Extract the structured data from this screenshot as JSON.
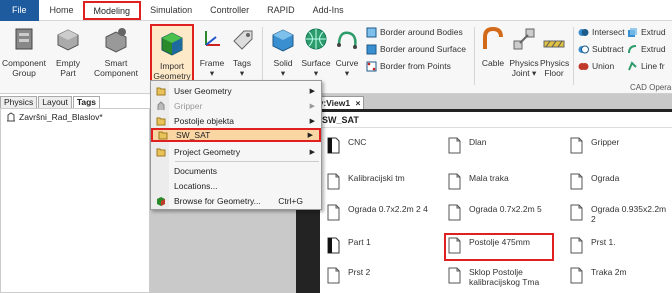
{
  "menu_tabs": [
    "File",
    "Home",
    "Modeling",
    "Simulation",
    "Controller",
    "RAPID",
    "Add-Ins"
  ],
  "ribbon": {
    "buttons": [
      {
        "label1": "Component",
        "label2": "Group"
      },
      {
        "label1": "Empty",
        "label2": "Part"
      },
      {
        "label1": "Smart",
        "label2": "Component"
      },
      {
        "label1": "Import",
        "label2": "Geometry ▾"
      },
      {
        "label1": "Frame",
        "label2": "▾"
      },
      {
        "label1": "Tags",
        "label2": "▾"
      },
      {
        "label1": "Solid",
        "label2": "▾"
      },
      {
        "label1": "Surface",
        "label2": "▾"
      },
      {
        "label1": "Curve",
        "label2": "▾"
      },
      {
        "label1": "Cable",
        "label2": ""
      },
      {
        "label1": "Physics",
        "label2": "Joint ▾"
      },
      {
        "label1": "Physics",
        "label2": "Floor"
      }
    ],
    "border_items": [
      "Border around Bodies",
      "Border around Surface",
      "Border from Points"
    ],
    "cad_items": [
      "Intersect",
      "Subtract",
      "Union"
    ],
    "cad_items2": [
      "Extrud",
      "Extrud",
      "Line fr"
    ],
    "cad_group_label": "CAD Opera"
  },
  "panel_tabs": [
    "Physics",
    "Layout",
    "Tags"
  ],
  "tree_item": "Završni_Rad_Blaslov*",
  "doc_tab": "ršni_Rad_Blaslov:View1",
  "doc_tab_close": "×",
  "dropdown": {
    "items": [
      {
        "label": "User Geometry",
        "arrow": "▶"
      },
      {
        "label": "Gripper",
        "arrow": "▶"
      },
      {
        "label": "Postolje objekta",
        "arrow": "▶"
      },
      {
        "label": "SW_SAT",
        "arrow": "▶"
      },
      {
        "label": "Project Geometry",
        "arrow": "▶"
      },
      {
        "label": "Documents",
        "arrow": ""
      },
      {
        "label": "Locations...",
        "arrow": ""
      },
      {
        "label": "Browse for Geometry...",
        "shortcut": "Ctrl+G",
        "arrow": ""
      }
    ]
  },
  "file_panel": {
    "title": "SW_SAT",
    "files": [
      [
        "CNC",
        "Dlan",
        "Gripper"
      ],
      [
        "Kalibracijski tm",
        "Mala traka",
        "Ograda"
      ],
      [
        "Ograda 0.7x2.2m 2 4",
        "Ograda 0.7x2.2m 5",
        "Ograda 0.935x2.2m 2"
      ],
      [
        "Part 1",
        "Postolje 475mm",
        "Prst 1."
      ],
      [
        "Prst 2",
        "Sklop Postolje kalibracijskog Tma",
        "Traka 2m"
      ]
    ]
  }
}
